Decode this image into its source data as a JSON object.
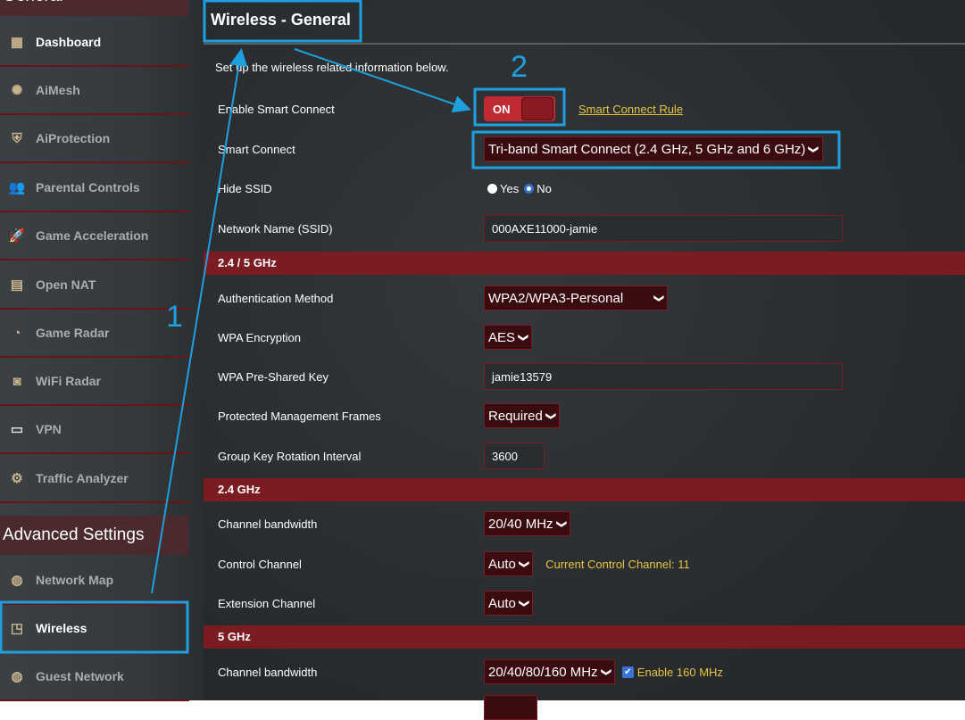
{
  "sidebar": {
    "general_heading": "General",
    "items": [
      {
        "label": "Dashboard",
        "icon": "dashboard-icon"
      },
      {
        "label": "AiMesh",
        "icon": "aimesh-icon"
      },
      {
        "label": "AiProtection",
        "icon": "shield-lock-icon"
      },
      {
        "label": "Parental Controls",
        "icon": "parental-icon"
      },
      {
        "label": "Game Acceleration",
        "icon": "rocket-icon"
      },
      {
        "label": "Open NAT",
        "icon": "open-nat-icon"
      },
      {
        "label": "Game Radar",
        "icon": "game-radar-icon"
      },
      {
        "label": "WiFi Radar",
        "icon": "wifi-radar-icon"
      },
      {
        "label": "VPN",
        "icon": "vpn-icon"
      },
      {
        "label": "Traffic Analyzer",
        "icon": "traffic-icon"
      }
    ],
    "advanced_heading": "Advanced Settings",
    "advanced_items": [
      {
        "label": "Network Map",
        "icon": "globe-icon"
      },
      {
        "label": "Wireless",
        "icon": "wireless-icon"
      },
      {
        "label": "Guest Network",
        "icon": "globe-icon"
      }
    ]
  },
  "main": {
    "title": "Wireless - General",
    "description": "Set up the wireless related information below.",
    "smart_connect_enable": {
      "label": "Enable Smart Connect",
      "toggle": "ON",
      "link": "Smart Connect Rule"
    },
    "smart_connect": {
      "label": "Smart Connect",
      "value": "Tri-band Smart Connect (2.4 GHz, 5 GHz and 6 GHz)"
    },
    "hide_ssid": {
      "label": "Hide SSID",
      "yes": "Yes",
      "no": "No",
      "selected": "No"
    },
    "ssid": {
      "label": "Network Name (SSID)",
      "value": "000AXE11000-jamie"
    },
    "sec_245": "2.4 / 5 GHz",
    "auth": {
      "label": "Authentication Method",
      "value": "WPA2/WPA3-Personal"
    },
    "enc": {
      "label": "WPA Encryption",
      "value": "AES"
    },
    "psk": {
      "label": "WPA Pre-Shared Key",
      "value": "jamie13579"
    },
    "pmf": {
      "label": "Protected Management Frames",
      "value": "Required"
    },
    "gkri": {
      "label": "Group Key Rotation Interval",
      "value": "3600"
    },
    "sec_24": "2.4 GHz",
    "bw24": {
      "label": "Channel bandwidth",
      "value": "20/40 MHz"
    },
    "ctrl24": {
      "label": "Control Channel",
      "value": "Auto",
      "note": "Current Control Channel: 11"
    },
    "ext24": {
      "label": "Extension Channel",
      "value": "Auto"
    },
    "sec_5": "5 GHz",
    "bw5": {
      "label": "Channel bandwidth",
      "value": "20/40/80/160 MHz",
      "checkbox": "Enable 160 MHz",
      "checked": true
    }
  },
  "annotations": {
    "step1": "1",
    "step2": "2",
    "color": "#1ea0e0"
  }
}
